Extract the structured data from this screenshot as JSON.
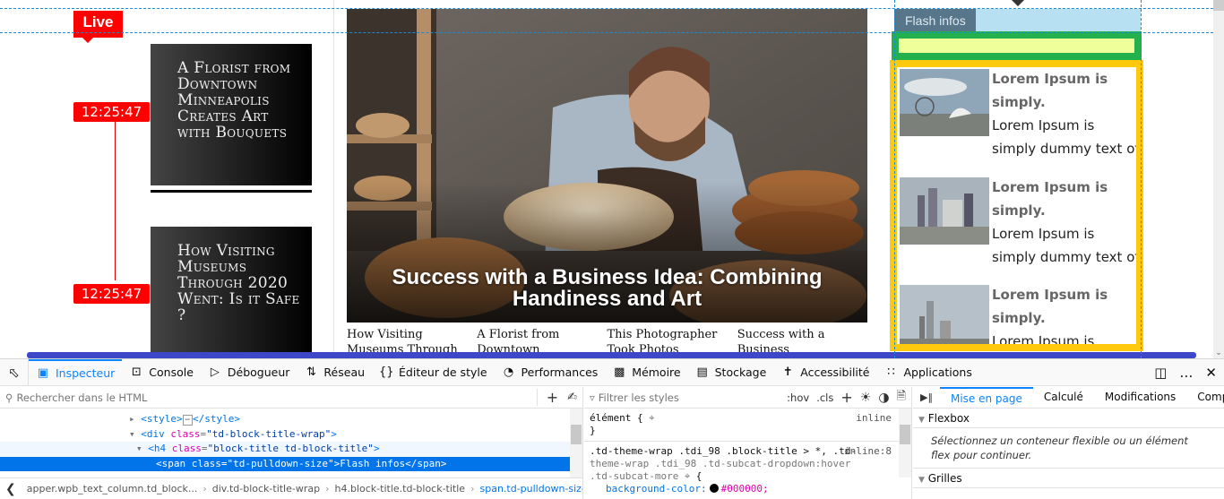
{
  "page": {
    "live_label": "Live",
    "timeline": [
      {
        "time": "12:25:47",
        "title": "A Florist from Downtown Minneapolis Creates Art with Bouquets"
      },
      {
        "time": "12:25:47",
        "title": "How Visiting Museums Through 2020 Went: Is it Safe ?"
      }
    ],
    "featured": {
      "title": "Success with a Business Idea: Combining Handiness and Art",
      "related": [
        "How Visiting Museums Through",
        "A Florist from Downtown",
        "This Photographer Took Photos",
        "Success with a Business"
      ]
    },
    "flash": {
      "title": "Flash infos",
      "items": [
        {
          "heading": "Lorem Ipsum is simply.",
          "line1": "Lorem Ipsum is",
          "line2": "simply dummy text of"
        },
        {
          "heading": "Lorem Ipsum is simply.",
          "line1": "Lorem Ipsum is",
          "line2": "simply dummy text of"
        },
        {
          "heading": "Lorem Ipsum is simply.",
          "line1": "Lorem Ipsum is",
          "line2": ""
        }
      ]
    },
    "colors": {
      "live_red": "#ff0000",
      "flash_tab": "#58768a",
      "flash_header_bg": "#b8e0f3",
      "green_outline": "#23b14d",
      "yellow_fill": "#efff9a",
      "yellow_outline": "#ffc90e",
      "overlay_blue": "#3d48c9"
    }
  },
  "devtools": {
    "tabs": [
      {
        "label": "Inspecteur",
        "icon": "inspector-icon",
        "active": true
      },
      {
        "label": "Console",
        "icon": "console-icon"
      },
      {
        "label": "Débogueur",
        "icon": "debugger-icon"
      },
      {
        "label": "Réseau",
        "icon": "network-icon"
      },
      {
        "label": "Éditeur de style",
        "icon": "style-editor-icon"
      },
      {
        "label": "Performances",
        "icon": "performance-icon"
      },
      {
        "label": "Mémoire",
        "icon": "memory-icon"
      },
      {
        "label": "Stockage",
        "icon": "storage-icon"
      },
      {
        "label": "Accessibilité",
        "icon": "accessibility-icon"
      },
      {
        "label": "Applications",
        "icon": "applications-icon"
      }
    ],
    "html_search_placeholder": "Rechercher dans le HTML",
    "tree": [
      {
        "text": "<style>…</style>"
      },
      {
        "tag_open": "div",
        "attr": "class",
        "value": "td-block-title-wrap"
      },
      {
        "tag_open": "h4",
        "attr": "class",
        "value": "block-title td-block-title"
      },
      {
        "selected": "<span class=\"td-pulldown-size\">Flash infos</span>"
      }
    ],
    "breadcrumbs": [
      "apper.wpb_text_column.td_block...",
      "div.td-block-title-wrap",
      "h4.block-title.td-block-title",
      "span.td-pulldown-size"
    ],
    "styles_filter_placeholder": "Filtrer les styles",
    "styles_toggles": [
      ":hov",
      ".cls"
    ],
    "rules": {
      "element_selector": "élément {",
      "element_close": "}",
      "element_source": "inline",
      "rule_selector_line1": ".td-theme-wrap .tdi_98 .block-title > *, .td-",
      "rule_selector_line2": "theme-wrap .tdi_98 .td-subcat-dropdown:hover",
      "rule_selector_line3": ".td-subcat-more",
      "rule_source": "inline:8",
      "property": "background-color:",
      "value": "#000000;"
    },
    "layout_tabs": [
      "Mise en page",
      "Calculé",
      "Modifications",
      "Compatil"
    ],
    "flexbox_label": "Flexbox",
    "flexbox_hint": "Sélectionnez un conteneur flexible ou un élément flex pour continuer.",
    "grid_label": "Grilles"
  }
}
